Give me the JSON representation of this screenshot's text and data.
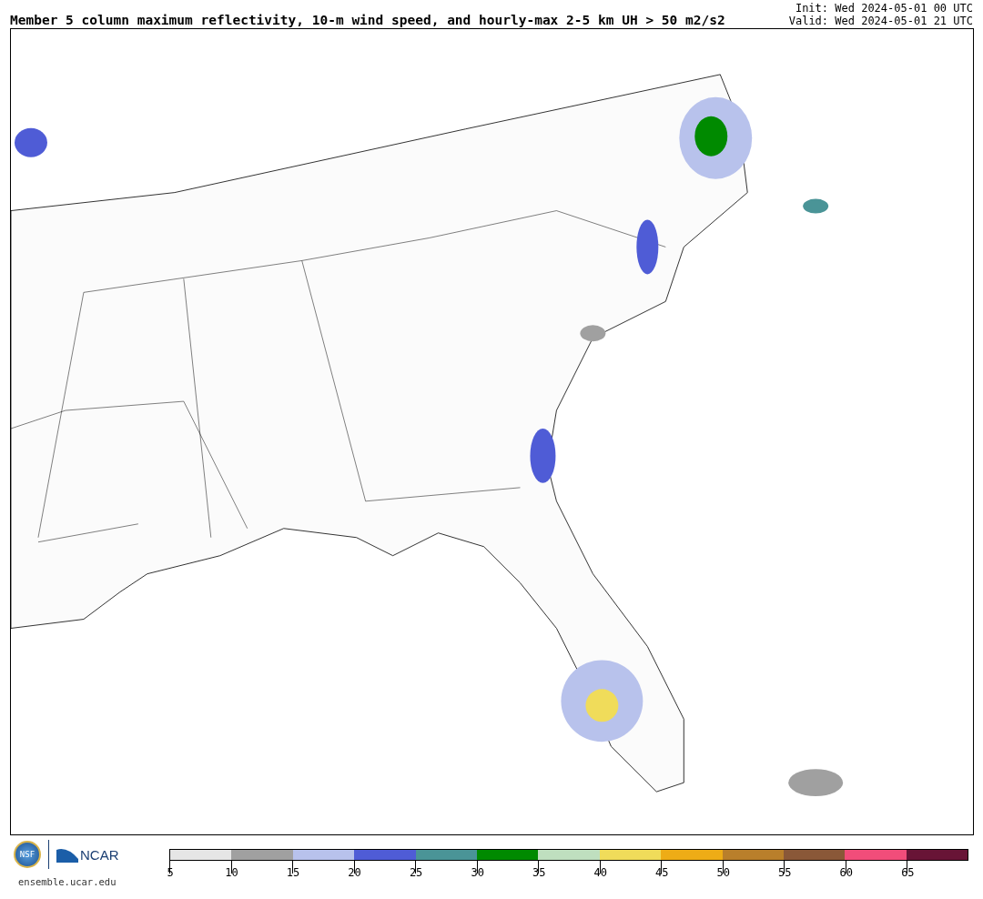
{
  "header": {
    "title": "Member 5 column maximum reflectivity, 10-m wind speed, and hourly-max 2-5 km UH > 50 m2/s2",
    "init": "Init: Wed 2024-05-01 00 UTC",
    "valid": "Valid: Wed 2024-05-01 21 UTC"
  },
  "footer": {
    "nsf_logo": "NSF",
    "ncar_logo": "NCAR",
    "site": "ensemble.ucar.edu"
  },
  "colorbar": {
    "segments": [
      {
        "color": "#e6e6e6"
      },
      {
        "color": "#a0a0a0"
      },
      {
        "color": "#b8c2ec"
      },
      {
        "color": "#4f5cd6"
      },
      {
        "color": "#4a9497"
      },
      {
        "color": "#008a00"
      },
      {
        "color": "#bfdfbf"
      },
      {
        "color": "#f0dc5a"
      },
      {
        "color": "#eeac16"
      },
      {
        "color": "#b97f2b"
      },
      {
        "color": "#8a5838"
      },
      {
        "color": "#f14d7a"
      },
      {
        "color": "#681436"
      }
    ],
    "ticks": [
      "5",
      "10",
      "15",
      "20",
      "25",
      "30",
      "35",
      "40",
      "45",
      "50",
      "55",
      "60",
      "65"
    ]
  }
}
